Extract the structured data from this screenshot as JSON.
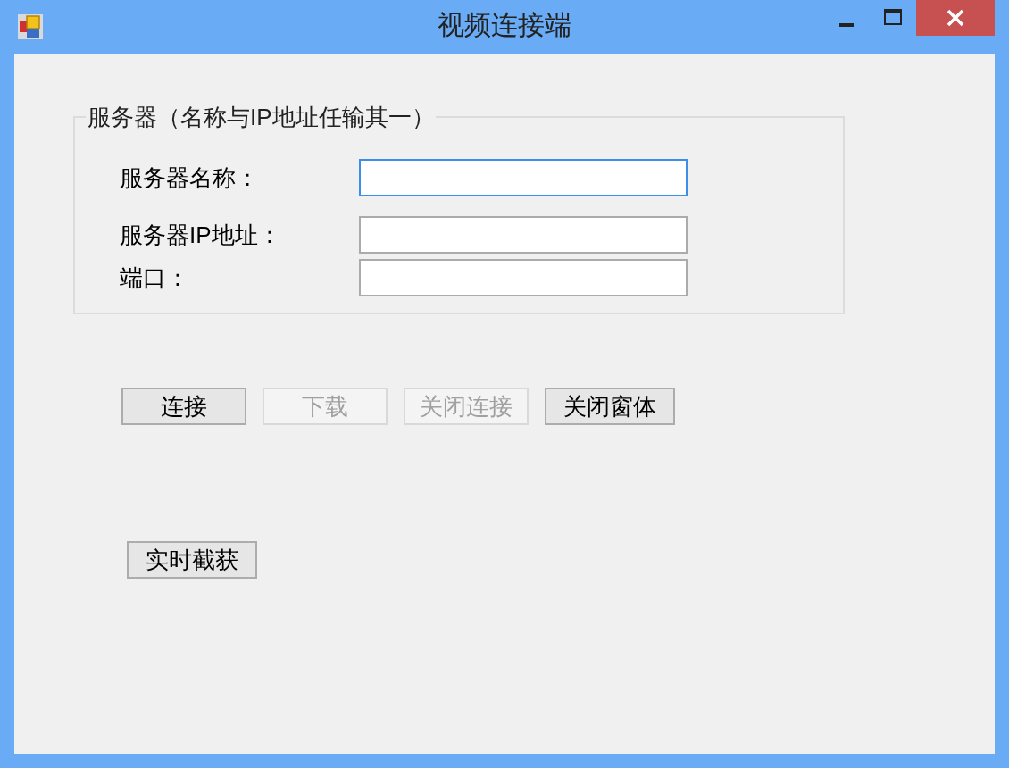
{
  "window": {
    "title": "视频连接端"
  },
  "group": {
    "title": "服务器（名称与IP地址任输其一）",
    "fields": [
      {
        "label": "服务器名称：",
        "focused": true
      },
      {
        "label": "服务器IP地址：",
        "focused": false
      },
      {
        "label": "端口：",
        "focused": false
      }
    ]
  },
  "buttons": [
    {
      "label": "连接",
      "disabled": false
    },
    {
      "label": "下载",
      "disabled": true
    },
    {
      "label": "关闭连接",
      "disabled": true
    },
    {
      "label": "关闭窗体",
      "disabled": false
    }
  ],
  "capture_button": {
    "label": "实时截获",
    "disabled": false
  }
}
